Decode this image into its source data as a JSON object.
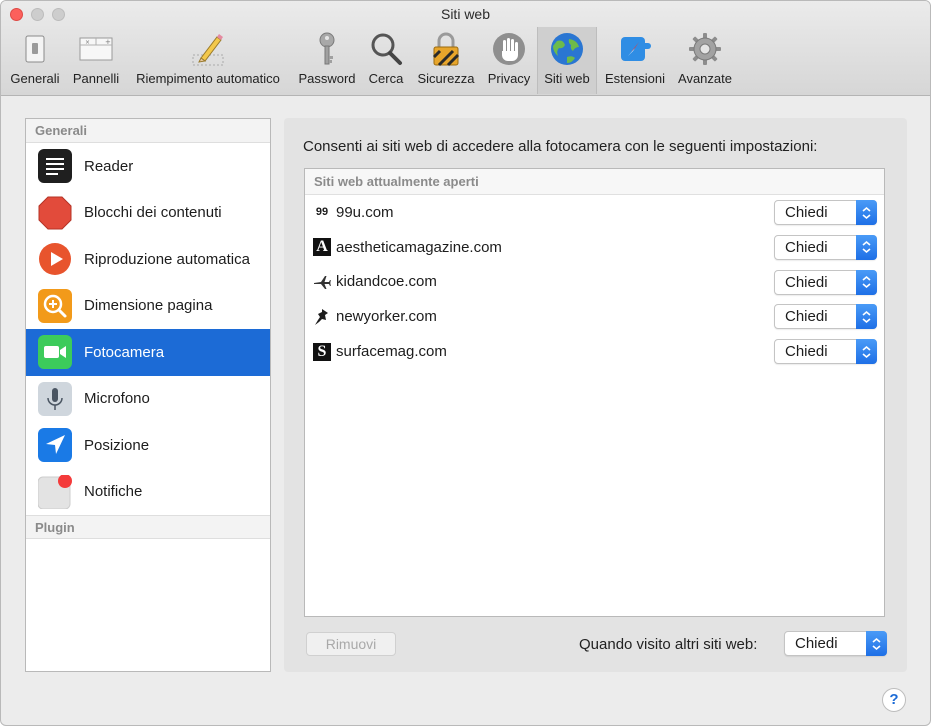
{
  "window": {
    "title": "Siti web"
  },
  "toolbar": {
    "items": [
      {
        "label": "Generali",
        "icon": "switch-icon"
      },
      {
        "label": "Pannelli",
        "icon": "tabs-icon"
      },
      {
        "label": "Riempimento automatico",
        "icon": "pencil-icon"
      },
      {
        "label": "Password",
        "icon": "key-icon"
      },
      {
        "label": "Cerca",
        "icon": "magnifier-icon"
      },
      {
        "label": "Sicurezza",
        "icon": "lock-icon"
      },
      {
        "label": "Privacy",
        "icon": "hand-icon"
      },
      {
        "label": "Siti web",
        "icon": "globe-icon",
        "active": true
      },
      {
        "label": "Estensioni",
        "icon": "compass-puzzle-icon"
      },
      {
        "label": "Avanzate",
        "icon": "gear-icon"
      }
    ]
  },
  "sidebar": {
    "general_header": "Generali",
    "plugin_header": "Plugin",
    "items": [
      {
        "label": "Reader",
        "icon": "reader-icon"
      },
      {
        "label": "Blocchi dei contenuti",
        "icon": "stop-sign-icon"
      },
      {
        "label": "Riproduzione automatica",
        "icon": "play-icon"
      },
      {
        "label": "Dimensione pagina",
        "icon": "zoom-icon"
      },
      {
        "label": "Fotocamera",
        "icon": "camera-icon",
        "selected": true
      },
      {
        "label": "Microfono",
        "icon": "microphone-icon"
      },
      {
        "label": "Posizione",
        "icon": "location-icon"
      },
      {
        "label": "Notifiche",
        "icon": "notification-icon"
      }
    ]
  },
  "main": {
    "heading": "Consenti ai siti web di accedere alla fotocamera con le seguenti impostazioni:",
    "table_header": "Siti web attualmente aperti",
    "sites": [
      {
        "name": "99u.com",
        "favicon": "99",
        "setting": "Chiedi"
      },
      {
        "name": "aestheticamagazine.com",
        "favicon": "A",
        "setting": "Chiedi"
      },
      {
        "name": "kidandcoe.com",
        "favicon": "plane-icon",
        "setting": "Chiedi"
      },
      {
        "name": "newyorker.com",
        "favicon": "pushpin-icon",
        "setting": "Chiedi"
      },
      {
        "name": "surfacemag.com",
        "favicon": "S",
        "setting": "Chiedi"
      }
    ],
    "remove_label": "Rimuovi",
    "other_sites_label": "Quando visito altri siti web:",
    "other_sites_value": "Chiedi"
  },
  "help": {
    "label": "?"
  },
  "colors": {
    "selection": "#1c6bd6",
    "stepper": "#2f80ed",
    "close": "#fc605c"
  }
}
